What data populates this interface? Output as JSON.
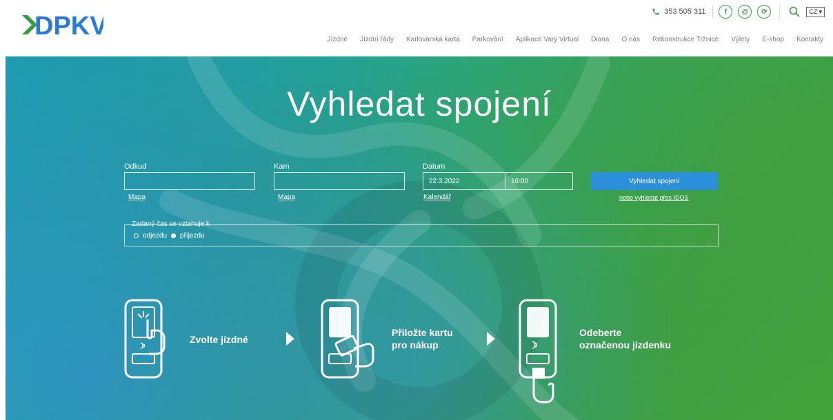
{
  "brand": {
    "logo_text": "DPKV",
    "colors": {
      "logo_green": "#3a9b45",
      "logo_blue": "#2a7bd6"
    }
  },
  "topbar": {
    "phone": "353 505 311",
    "social": [
      {
        "name": "facebook",
        "label": "f"
      },
      {
        "name": "email",
        "label": "@"
      },
      {
        "name": "app",
        "label": "⟳"
      }
    ],
    "language": "CZ"
  },
  "nav": {
    "items": [
      "Jízdné",
      "Jízdní řády",
      "Karlovarská karta",
      "Parkování",
      "Aplikace Vary Virtual",
      "Diana",
      "O nás",
      "Rekonstrukce Tržnice",
      "Výlety",
      "E-shop",
      "Kontakty"
    ]
  },
  "hero": {
    "title": "Vyhledat spojení",
    "from_label": "Odkud",
    "from_map_link": "Mapa",
    "to_label": "Kam",
    "to_map_link": "Mapa",
    "date_label": "Datum",
    "date_value": "22.3.2022",
    "time_value": "16:00",
    "calendar_link": "Kalendář",
    "search_button": "Vyhledat spojení",
    "idos_link": "nebo vyhledat přes IDOS",
    "time_legend": "Zadaný čas se vztahuje k",
    "radio_departure": "odjezdu",
    "radio_arrival": "příjezdu",
    "selected_radio": "arrival"
  },
  "steps": [
    {
      "line1": "Zvolte jízdné",
      "line2": ""
    },
    {
      "line1": "Přiložte kartu",
      "line2": "pro nákup"
    },
    {
      "line1": "Odeberte",
      "line2": "označenou jízdenku"
    }
  ]
}
